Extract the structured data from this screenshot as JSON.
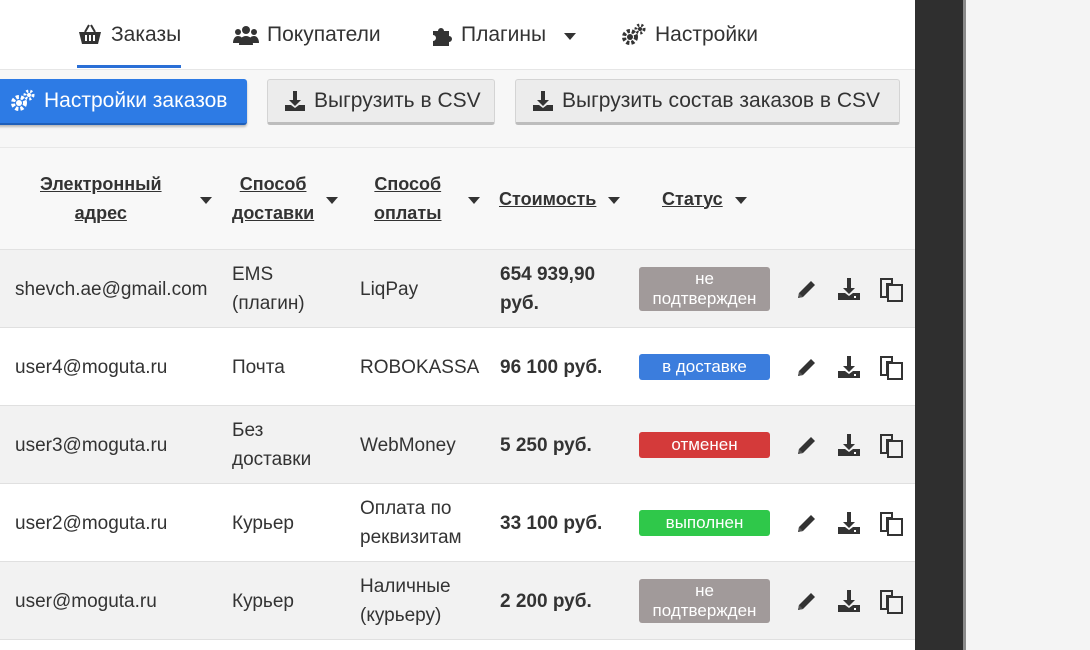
{
  "colors": {
    "accent": "#2d7be5",
    "status_unconfirmed": "#a19a9a",
    "status_delivery": "#3b7ddd",
    "status_cancelled": "#d43a3a",
    "status_done": "#2fc84a"
  },
  "nav": {
    "items": [
      {
        "label": "Заказы",
        "icon": "basket-icon",
        "active": true
      },
      {
        "label": "Покупатели",
        "icon": "users-icon"
      },
      {
        "label": "Плагины",
        "icon": "puzzle-icon",
        "dropdown": true
      },
      {
        "label": "Настройки",
        "icon": "gears-icon"
      }
    ]
  },
  "toolbar": {
    "order_settings": "Настройки заказов",
    "export_csv": "Выгрузить в CSV",
    "export_items_csv": "Выгрузить состав заказов в CSV"
  },
  "table": {
    "headers": {
      "email": [
        "Электронный",
        "адрес"
      ],
      "delivery": [
        "Способ",
        "доставки"
      ],
      "payment": [
        "Способ",
        "оплаты"
      ],
      "price": "Стоимость",
      "status": "Статус"
    },
    "rows": [
      {
        "email": "shevch.ae@gmail.com",
        "delivery": [
          "EMS",
          "(плагин)"
        ],
        "payment": [
          "LiqPay"
        ],
        "price": [
          "654 939,90",
          "руб."
        ],
        "status": [
          "не",
          "подтвержден"
        ],
        "status_color": "#a19a9a"
      },
      {
        "email": "user4@moguta.ru",
        "delivery": [
          "Почта"
        ],
        "payment": [
          "ROBOKASSA"
        ],
        "price": [
          "96 100 руб."
        ],
        "status": [
          "в доставке"
        ],
        "status_color": "#3b7ddd"
      },
      {
        "email": "user3@moguta.ru",
        "delivery": [
          "Без",
          "доставки"
        ],
        "payment": [
          "WebMoney"
        ],
        "price": [
          "5 250 руб."
        ],
        "status": [
          "отменен"
        ],
        "status_color": "#d43a3a"
      },
      {
        "email": "user2@moguta.ru",
        "delivery": [
          "Курьер"
        ],
        "payment": [
          "Оплата по",
          "реквизитам"
        ],
        "price": [
          "33 100 руб."
        ],
        "status": [
          "выполнен"
        ],
        "status_color": "#2fc84a"
      },
      {
        "email": "user@moguta.ru",
        "delivery": [
          "Курьер"
        ],
        "payment": [
          "Наличные",
          "(курьеру)"
        ],
        "price": [
          "2 200 руб."
        ],
        "status": [
          "не",
          "подтвержден"
        ],
        "status_color": "#a19a9a"
      }
    ],
    "row_actions": [
      "edit-icon",
      "download-icon",
      "copy-icon"
    ]
  }
}
